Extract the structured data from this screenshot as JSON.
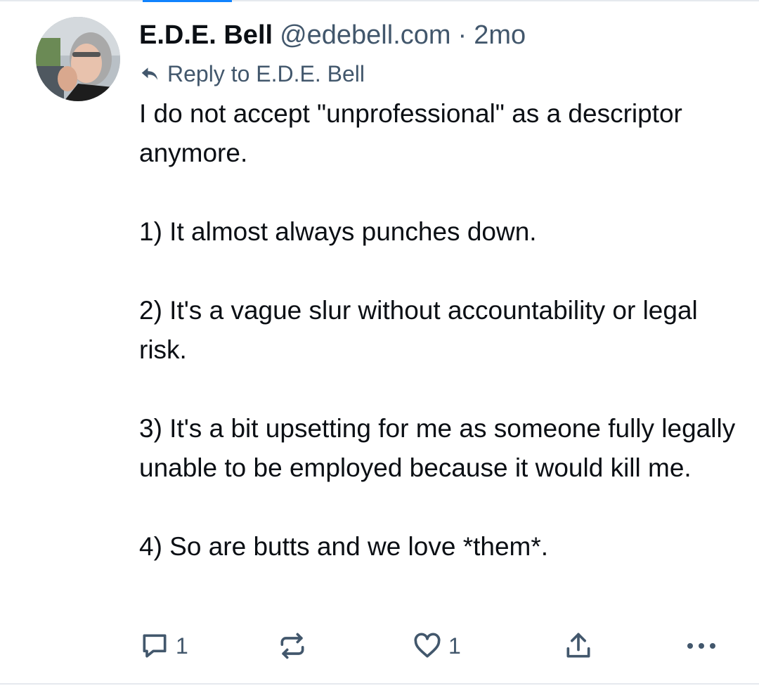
{
  "post": {
    "author_name": "E.D.E. Bell",
    "author_handle": "@edebell.com",
    "separator": "·",
    "timestamp": "2mo",
    "reply_to": "Reply to E.D.E. Bell",
    "paragraphs": [
      "I do not accept \"unprofessional\" as a descriptor anymore.",
      "1) It almost always punches down.",
      "2) It's a vague slur without accountability or legal risk.",
      "3) It's a bit upsetting for me as someone fully legally unable to be employed because it would kill me.",
      "4) So are butts and we love *them*."
    ]
  },
  "actions": {
    "reply_count": "1",
    "like_count": "1"
  },
  "icons": {
    "reply": "reply-arrow-icon",
    "comment": "speech-bubble-icon",
    "repost": "repost-arrows-icon",
    "like": "heart-icon",
    "share": "share-upload-icon",
    "more": "more-dots-icon"
  },
  "colors": {
    "text_primary": "#0b0f14",
    "text_secondary": "#42576c",
    "tab_indicator": "#1083fe",
    "divider": "#e5e9ee"
  }
}
